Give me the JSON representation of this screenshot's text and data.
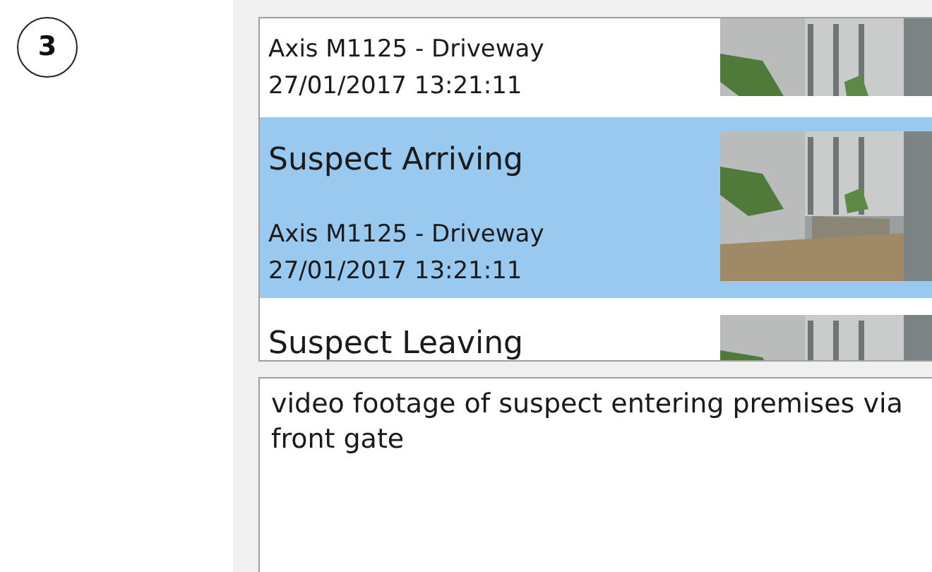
{
  "step_marker": "3",
  "events": [
    {
      "camera": "Axis M1125 - Driveway",
      "time": "27/01/2017 13:21:11",
      "selected": false
    },
    {
      "title": "Suspect Arriving",
      "camera": "Axis M1125 - Driveway",
      "time": "27/01/2017 13:21:11",
      "selected": true
    },
    {
      "title": "Suspect Leaving",
      "selected": false
    }
  ],
  "notes": {
    "value": "video footage of suspect entering premises via front gate"
  }
}
